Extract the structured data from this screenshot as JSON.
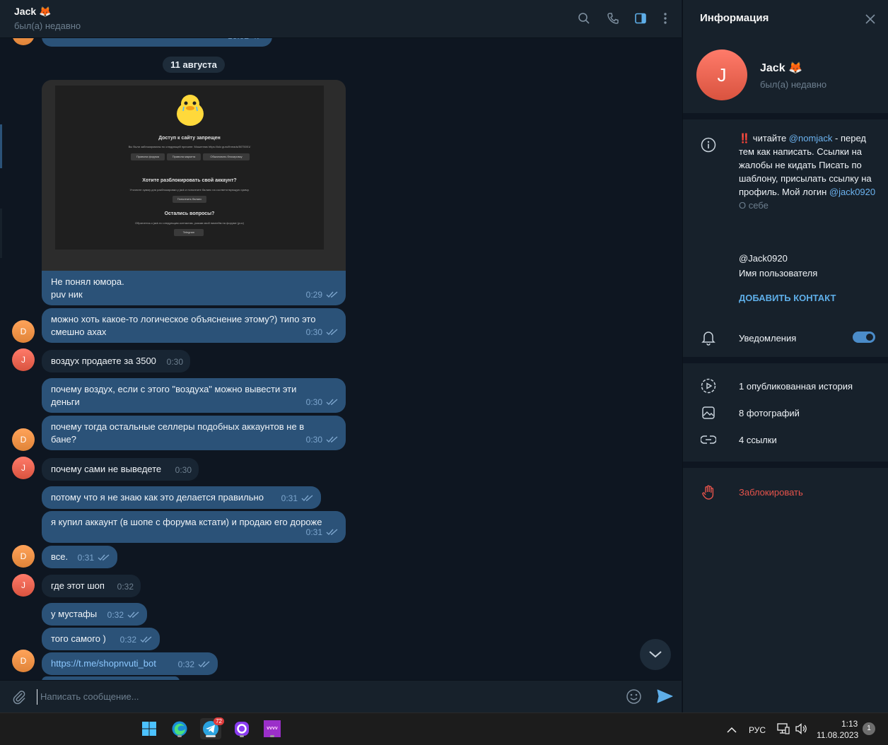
{
  "chat": {
    "title": "Jack 🦊",
    "status": "был(а) недавно",
    "top_partial_time": "16:02",
    "date_pill": "11 августа",
    "photo": {
      "heading1": "Доступ к сайту запрещен",
      "text1": "Вы были заблокированы по следующей причине: Мошенник https://lolz.guru/threads/5075001/",
      "btn1": "Правила форума",
      "btn2": "Правила маркета",
      "btn3": "Обжаловать блокировку",
      "heading2": "Хотите разблокировать свой аккаунт?",
      "text2": "Уточните сумму для разблокировки у jack и пополните баланс на соответствующую сумму.",
      "btn4": "Пополнить баланс",
      "heading3": "Остались вопросы?",
      "text3": "Обратитесь к jack по следующим контактам, указав свой никнейм на форуме (puv)",
      "btn5": "Telegram"
    },
    "messages": [
      {
        "text": "Не понял юмора.\npuv ник",
        "time": "0:29"
      },
      {
        "text": "можно хоть какое-то логическое объяснение этому?) типо это смешно ахах",
        "time": "0:30"
      },
      {
        "text": "воздух продаете за 3500",
        "time": "0:30"
      },
      {
        "text": "почему воздух, если с этого \"воздуха\" можно вывести эти деньги",
        "time": "0:30"
      },
      {
        "text": "почему тогда остальные селлеры подобных аккаунтов не в бане?",
        "time": "0:30"
      },
      {
        "text": "почему сами не выведете",
        "time": "0:30"
      },
      {
        "text": "потому что я не знаю как это делается правильно",
        "time": "0:31"
      },
      {
        "text": "я купил аккаунт (в шопе с форума кстати) и продаю его дороже",
        "time": "0:31"
      },
      {
        "text": "все.",
        "time": "0:31"
      },
      {
        "text": "где этот шоп",
        "time": "0:32"
      },
      {
        "text": "у мустафы",
        "time": "0:32"
      },
      {
        "text": "того самого )",
        "time": "0:32"
      },
      {
        "text": "https://t.me/shopnvuti_bot",
        "time": "0:32"
      }
    ],
    "avatar_d": "D",
    "avatar_j": "J",
    "composer_placeholder": "Написать сообщение..."
  },
  "info": {
    "title": "Информация",
    "avatar_letter": "J",
    "name": "Jack 🦊",
    "status": "был(а) недавно",
    "bio_prefix": "‼️ читайте ",
    "bio_mention": "@nomjack",
    "bio_rest1": " - перед тем как написать. Ссылки на жалобы не кидать Писать по шаблону, присылать ссылку на профиль. Мой логин ",
    "bio_login": "@jack0920",
    "bio_label": "О себе",
    "username": "@Jack0920",
    "username_label": "Имя пользователя",
    "add_contact": "ДОБАВИТЬ КОНТАКТ",
    "notifications": "Уведомления",
    "notifications_on": true,
    "stories": "1 опубликованная история",
    "photos": "8 фотографий",
    "links": "4 ссылки",
    "block": "Заблокировать"
  },
  "taskbar": {
    "telegram_badge": "72",
    "lang": "РУС",
    "time": "1:13",
    "date": "11.08.2023",
    "notifications_count": "1",
    "app5_label": "vvvv"
  },
  "colors": {
    "bg": "#0e1621",
    "panel": "#17212b",
    "bubble_out": "#2b5278",
    "bubble_in": "#182533",
    "accent": "#5eaee8",
    "danger": "#e5534b"
  }
}
